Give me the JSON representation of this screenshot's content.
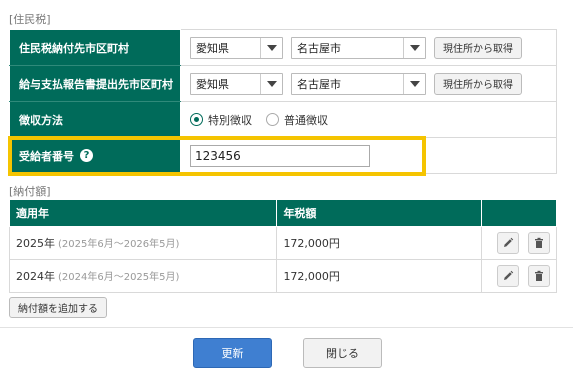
{
  "resident_tax": {
    "section_label": "[住民税]",
    "rows": {
      "payment_city": {
        "label": "住民税納付先市区町村",
        "prefecture": "愛知県",
        "city": "名古屋市",
        "button": "現住所から取得"
      },
      "report_city": {
        "label": "給与支払報告書提出先市区町村",
        "prefecture": "愛知県",
        "city": "名古屋市",
        "button": "現住所から取得"
      },
      "collection_method": {
        "label": "徴収方法",
        "options": [
          "特別徴収",
          "普通徴収"
        ],
        "selected": "特別徴収"
      },
      "recipient_number": {
        "label": "受給者番号",
        "help_icon": "question-circle-icon",
        "value": "123456"
      }
    }
  },
  "payment_amounts": {
    "section_label": "[納付額]",
    "headers": [
      "適用年",
      "年税額",
      ""
    ],
    "rows": [
      {
        "year": "2025年",
        "period": "(2025年6月～2026年5月)",
        "amount": "172,000円"
      },
      {
        "year": "2024年",
        "period": "(2024年6月～2025年5月)",
        "amount": "172,000円"
      }
    ],
    "add_button": "納付額を追加する"
  },
  "footer": {
    "update_button": "更新",
    "close_button": "閉じる"
  },
  "colors": {
    "header_green": "#006b5a",
    "highlight": "#f5c400",
    "primary_blue": "#3f7fd1"
  }
}
